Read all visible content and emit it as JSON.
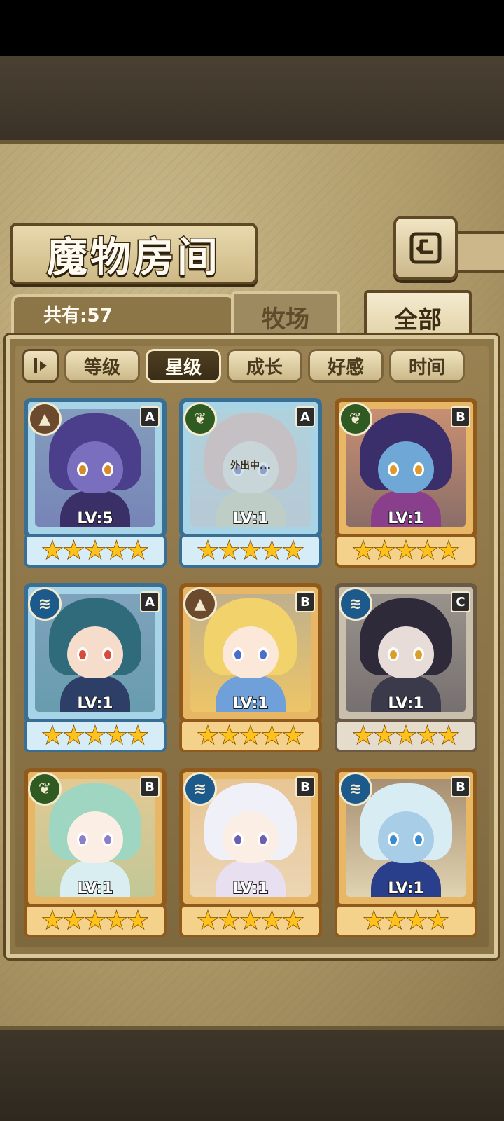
{
  "header": {
    "title": "魔物房间",
    "back_icon": "back-arrow-icon"
  },
  "tabs": {
    "count_label": "共有:57",
    "farm_label": "牧场",
    "all_label": "全部",
    "active_tab": "all"
  },
  "sort": {
    "toggle_icon": "sort-order-icon",
    "options": [
      {
        "label": "等级",
        "active": false
      },
      {
        "label": "星级",
        "active": true
      },
      {
        "label": "成长",
        "active": false
      },
      {
        "label": "好感",
        "active": false
      },
      {
        "label": "时间",
        "active": false
      }
    ]
  },
  "monsters": [
    {
      "element": "earth",
      "element_icon": "mountain-icon",
      "rank": "A",
      "level": "LV:5",
      "stars": 5,
      "away": false,
      "hair": "#4b3f8c",
      "skin": "#7a6fbf",
      "eye": "#d88a2a",
      "body": "#3a2f66"
    },
    {
      "element": "nature",
      "element_icon": "leaf-icon",
      "rank": "A",
      "level": "LV:1",
      "stars": 5,
      "away": true,
      "away_text": "外出中...",
      "hair": "#e8a89a",
      "skin": "#f2d9c8",
      "eye": "#7a5f9c",
      "body": "#d9c8a0"
    },
    {
      "element": "nature",
      "element_icon": "leaf-icon",
      "rank": "B",
      "level": "LV:1",
      "stars": 5,
      "away": false,
      "hair": "#3a2e6b",
      "skin": "#6fa8d6",
      "eye": "#e09a2a",
      "body": "#8a3f8c"
    },
    {
      "element": "water",
      "element_icon": "water-waves-icon",
      "rank": "A",
      "level": "LV:1",
      "stars": 5,
      "away": false,
      "hair": "#2f6b7a",
      "skin": "#f5dccb",
      "eye": "#d84a3a",
      "body": "#2d3f66"
    },
    {
      "element": "earth",
      "element_icon": "mountain-icon",
      "rank": "B",
      "level": "LV:1",
      "stars": 5,
      "away": false,
      "hair": "#f2d26a",
      "skin": "#fbe8d8",
      "eye": "#4a6fc9",
      "body": "#6fa0d9"
    },
    {
      "element": "water",
      "element_icon": "water-waves-icon",
      "rank": "C",
      "level": "LV:1",
      "stars": 5,
      "away": false,
      "hair": "#2e2a3a",
      "skin": "#e8dcd8",
      "eye": "#d8a02a",
      "body": "#3a3a4a"
    },
    {
      "element": "nature",
      "element_icon": "leaf-icon",
      "rank": "B",
      "level": "LV:1",
      "stars": 5,
      "away": false,
      "hair": "#9fd6c2",
      "skin": "#fbeee4",
      "eye": "#8a7fc9",
      "body": "#d9eef0"
    },
    {
      "element": "water",
      "element_icon": "water-waves-icon",
      "rank": "B",
      "level": "LV:1",
      "stars": 5,
      "away": false,
      "hair": "#f0f0f8",
      "skin": "#fbeee4",
      "eye": "#6a5fb0",
      "body": "#e8e0f0"
    },
    {
      "element": "water",
      "element_icon": "water-waves-icon",
      "rank": "B",
      "level": "LV:1",
      "stars": 4,
      "away": false,
      "hair": "#d8ecf4",
      "skin": "#a8cde6",
      "eye": "#3a8ad0",
      "body": "#2a3f8c"
    }
  ]
}
